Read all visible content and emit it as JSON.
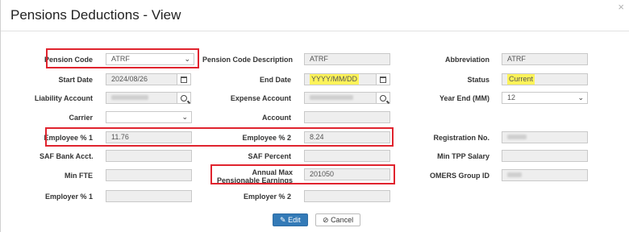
{
  "modal": {
    "title": "Pensions Deductions - View",
    "close": "×"
  },
  "fields": {
    "pension_code": {
      "label": "Pension Code",
      "value": "ATRF"
    },
    "pension_code_description": {
      "label": "Pension Code Description",
      "value": "ATRF"
    },
    "abbreviation": {
      "label": "Abbreviation",
      "value": "ATRF"
    },
    "start_date": {
      "label": "Start Date",
      "value": "2024/08/26"
    },
    "end_date": {
      "label": "End Date",
      "value": "YYYY/MM/DD"
    },
    "status": {
      "label": "Status",
      "value": "Current"
    },
    "liability_account": {
      "label": "Liability Account",
      "value": ""
    },
    "expense_account": {
      "label": "Expense Account",
      "value": ""
    },
    "year_end": {
      "label": "Year End (MM)",
      "value": "12"
    },
    "carrier": {
      "label": "Carrier",
      "value": ""
    },
    "account": {
      "label": "Account",
      "value": ""
    },
    "employee_pct_1": {
      "label": "Employee % 1",
      "value": "11.76"
    },
    "employee_pct_2": {
      "label": "Employee % 2",
      "value": "8.24"
    },
    "registration_no": {
      "label": "Registration No.",
      "value": ""
    },
    "saf_bank_acct": {
      "label": "SAF Bank Acct.",
      "value": ""
    },
    "saf_percent": {
      "label": "SAF Percent",
      "value": ""
    },
    "min_tpp_salary": {
      "label": "Min TPP Salary",
      "value": ""
    },
    "min_fte": {
      "label": "Min FTE",
      "value": ""
    },
    "annual_max_pensionable_earnings": {
      "label": "Annual Max Pensionable Earnings",
      "value": "201050"
    },
    "omers_group_id": {
      "label": "OMERS Group ID",
      "value": ""
    },
    "employer_pct_1": {
      "label": "Employer % 1",
      "value": ""
    },
    "employer_pct_2": {
      "label": "Employer % 2",
      "value": ""
    }
  },
  "buttons": {
    "edit": "Edit",
    "cancel": "Cancel"
  },
  "icons": {
    "calendar": "calendar-icon",
    "search": "search-icon",
    "chevron": "chevron-down-icon",
    "edit": "edit-icon",
    "cancel": "cancel-circle-icon"
  },
  "colors": {
    "highlight": "#fdf35a",
    "annotation_red": "#e0242e",
    "primary_button": "#337ab7"
  }
}
